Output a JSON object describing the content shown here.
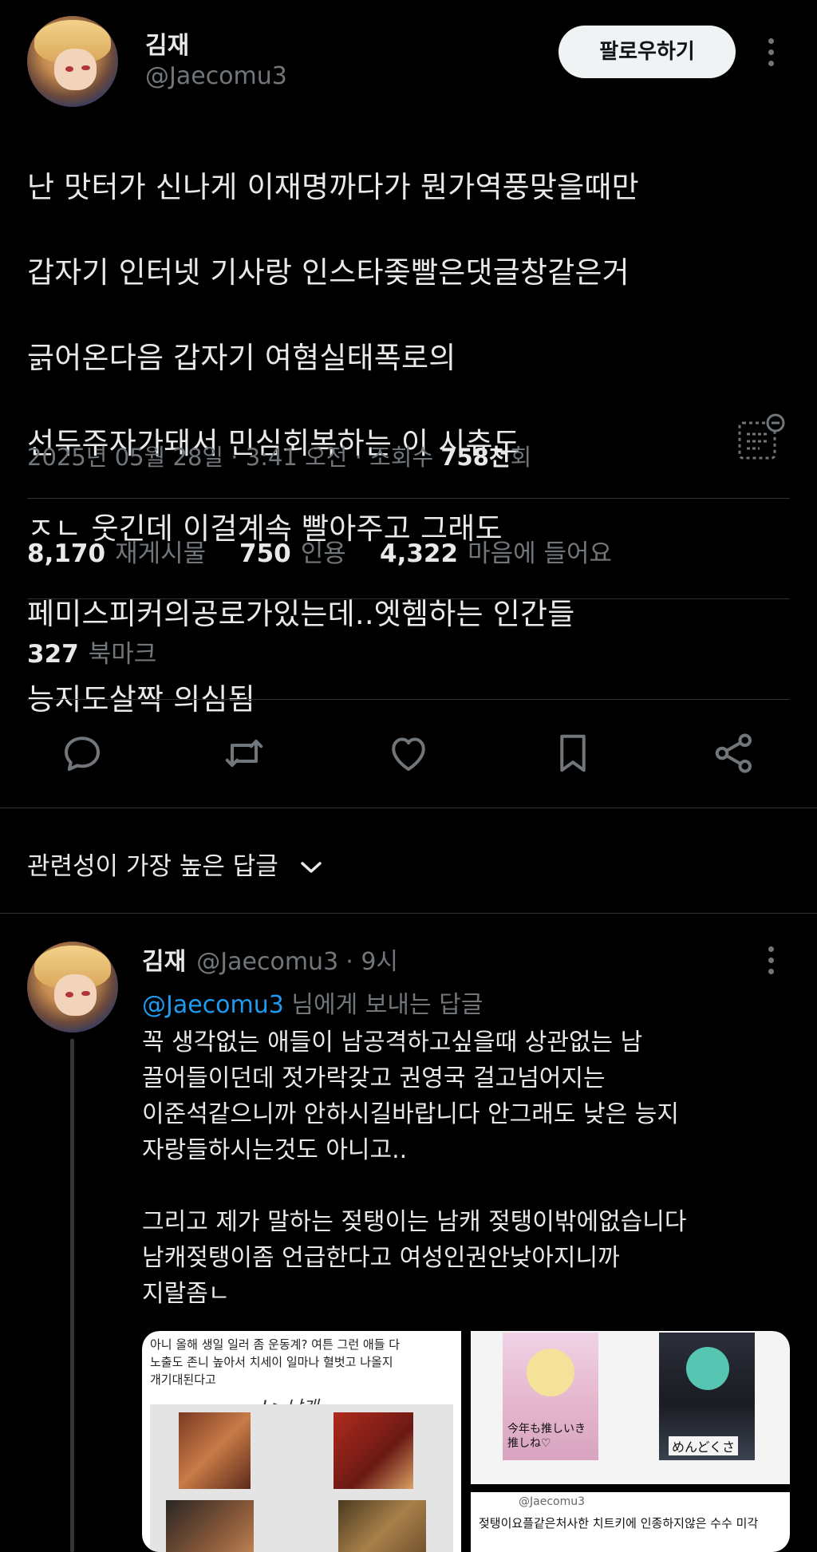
{
  "tweet": {
    "author_name": "김재",
    "author_handle": "@Jaecomu3",
    "follow_label": "팔로우하기",
    "text_lines": [
      "난 맛터가 신나게 이재명까다가 뭔가역풍맞을때만",
      "갑자기 인터넷 기사랑 인스타좆빨은댓글창같은거",
      "긁어온다음 갑자기 여혐실태폭로의",
      "선두주자가돼서 민심회복하는 이 시츄도",
      "ㅈㄴ 웃긴데 이걸계속 빨아주고 그래도",
      "페미스피커의공로가있는데..엣헴하는 인간들",
      "능지도살짝 의심됨"
    ],
    "date": "2025년 05월 28일 · 3:41 오전 · 조회수",
    "views": "758천",
    "views_suffix": "회"
  },
  "stats": {
    "reposts_num": "8,170",
    "reposts_label": "재게시물",
    "quotes_num": "750",
    "quotes_label": "인용",
    "likes_num": "4,322",
    "likes_label": "마음에 들어요",
    "bookmarks_num": "327",
    "bookmarks_label": "북마크"
  },
  "actions": [
    "reply-icon",
    "repost-icon",
    "like-icon",
    "bookmark-icon",
    "share-icon"
  ],
  "replies_section": {
    "title": "관련성이 가장 높은 답글"
  },
  "reply": {
    "author_name": "김재",
    "author_handle": "@Jaecomu3",
    "time": "· 9시",
    "replying_mention": "@Jaecomu3",
    "replying_suffix": "님에게 보내는 답글",
    "text": "꼭 생각없는 애들이 남공격하고싶을때 상관없는 남\n끌어들이던데 젓가락갖고 권영국 걸고넘어지는\n이준석같으니까 안하시길바랍니다 안그래도 낮은 능지\n자랑들하시는것도 아니고..\n\n그리고 제가 말하는 젖탱이는 남캐 젖탱이밖에없습니다\n남캐젖탱이좀 언급한다고 여성인권안낮아지니까\n지랄좀ㄴ",
    "image1_note": "아니 올해 생일 일러 좀 운동계? 여튼 그런 애들 다\n노출도 존니 높아서 치세이 일마나 혈벗고 나올지\n개기대된다고",
    "image1_scribble": "L>남캐",
    "image2_sign_left": "今年も推しいき\n推しね♡",
    "image2_sign_right": "めんどくさ",
    "image3_handle": "@Jaecomu3",
    "image3_text": "젖탱이요플같은처사한 치트키에 인종하지않은 수수 미각"
  },
  "colors": {
    "background": "#000000",
    "text_primary": "#e7e9ea",
    "text_secondary": "#71767b",
    "link": "#1d9bf0",
    "divider": "#2f3336"
  }
}
